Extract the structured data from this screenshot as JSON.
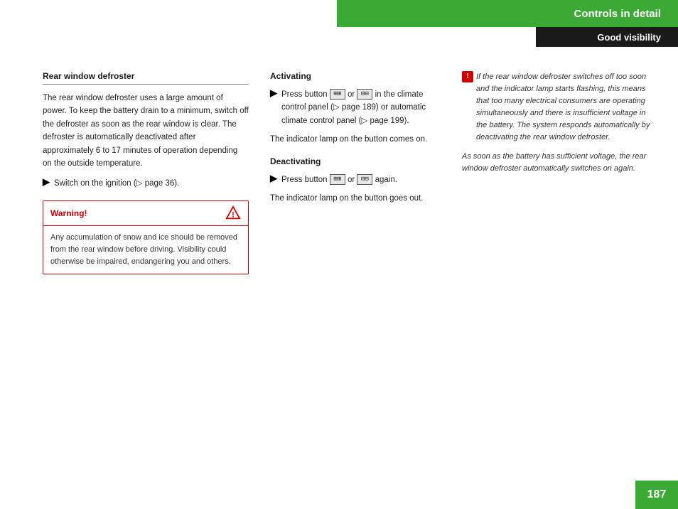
{
  "header": {
    "title": "Controls in detail",
    "subtitle": "Good visibility"
  },
  "left": {
    "section_title": "Rear window defroster",
    "body": "The rear window defroster uses a large amount of power. To keep the battery drain to a minimum, switch off the defroster as soon as the rear window is clear. The defroster is automatically deactivated after approximately 6 to 17 minutes of operation depending on the outside temperature.",
    "bullet": "Switch on the ignition (▷ page 36).",
    "warning_label": "Warning!",
    "warning_body": "Any accumulation of snow and ice should be removed from the rear window before driving. Visibility could otherwise be impaired, endangering you and others."
  },
  "mid": {
    "activating_title": "Activating",
    "activating_line1": "Press button",
    "activating_btn1": "▦▦▦",
    "activating_or": "or",
    "activating_btn2": "▦▦",
    "activating_line2": "in the climate control panel (▷ page 189) or automatic climate control panel (▷ page 199).",
    "activating_lamp": "The indicator lamp on the button comes on.",
    "deactivating_title": "Deactivating",
    "deactivating_line1": "Press button",
    "deactivating_btn1": "▦▦▦",
    "deactivating_or": "or",
    "deactivating_btn2": "▦▦",
    "deactivating_again": "again.",
    "deactivating_lamp": "The indicator lamp on the button goes out."
  },
  "right": {
    "info_icon": "!",
    "para1": "If the rear window defroster switches off too soon and the indicator lamp starts flashing, this means that too many electrical consumers are operating simultaneously and there is insufficient voltage in the battery. The system responds automatically by deactivating the rear window defroster.",
    "para2": "As soon as the battery has sufficient voltage, the rear window defroster automatically switches on again."
  },
  "page": {
    "number": "187"
  }
}
